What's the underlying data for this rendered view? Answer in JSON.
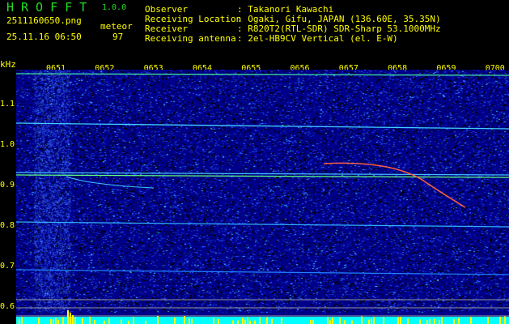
{
  "header": {
    "app_title": "HROFFT",
    "version": "1.0.0",
    "filename": "2511160650.png",
    "datetime": "25.11.16 06:50",
    "meteor_label": "meteor",
    "meteor_count": "97",
    "info": [
      {
        "label": "Observer",
        "value": "Takanori Kawachi"
      },
      {
        "label": "Receiving Location",
        "value": "Ogaki, Gifu, JAPAN (136.60E, 35.35N)"
      },
      {
        "label": "Receiver",
        "value": "R820T2(RTL-SDR) SDR-Sharp 53.1000MHz"
      },
      {
        "label": "Receiving antenna",
        "value": "2el-HB9CV Vertical (el. E-W)"
      }
    ]
  },
  "colors": {
    "text": "#ffff00",
    "title": "#22dd22",
    "background_noise": "#0a1a9a",
    "histogram": "#00ffff",
    "histogram_peaks": "#ffff00"
  },
  "chart_data": {
    "type": "heatmap",
    "ylabel": "kHz",
    "y_ticks": [
      "1.1",
      "1.0",
      "0.9",
      "0.8",
      "0.7",
      "0.6"
    ],
    "ylim": [
      0.58,
      1.17
    ],
    "x_ticks": [
      "0651",
      "0652",
      "0653",
      "0654",
      "0655",
      "0656",
      "0657",
      "0658",
      "0659",
      "0700"
    ]
  }
}
